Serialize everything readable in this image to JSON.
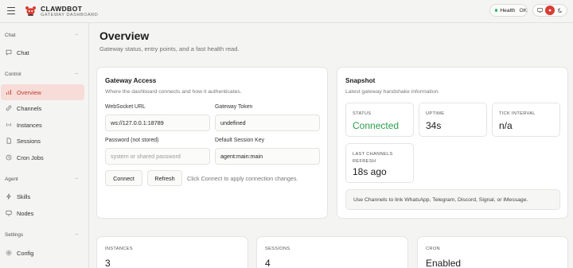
{
  "brand": {
    "title": "CLAWDBOT",
    "subtitle": "GATEWAY DASHBOARD"
  },
  "health": {
    "label": "Health",
    "status": "OK",
    "status_color": "#2fb85a"
  },
  "sidebar": {
    "sections": [
      {
        "label": "Chat",
        "items": [
          {
            "label": "Chat",
            "icon": "chat-icon"
          }
        ]
      },
      {
        "label": "Control",
        "items": [
          {
            "label": "Overview",
            "icon": "bar-chart-icon",
            "active": true
          },
          {
            "label": "Channels",
            "icon": "link-icon"
          },
          {
            "label": "Instances",
            "icon": "broadcast-icon"
          },
          {
            "label": "Sessions",
            "icon": "document-icon"
          },
          {
            "label": "Cron Jobs",
            "icon": "clock-icon"
          }
        ]
      },
      {
        "label": "Agent",
        "items": [
          {
            "label": "Skills",
            "icon": "bolt-icon"
          },
          {
            "label": "Nodes",
            "icon": "monitor-icon"
          }
        ]
      },
      {
        "label": "Settings",
        "items": [
          {
            "label": "Config",
            "icon": "gear-icon"
          }
        ]
      }
    ]
  },
  "page": {
    "title": "Overview",
    "subtitle": "Gateway status, entry points, and a fast health read."
  },
  "gateway": {
    "title": "Gateway Access",
    "subtitle": "Where the dashboard connects and how it authenticates.",
    "ws_label": "WebSocket URL",
    "ws_value": "ws://127.0.0.1:18789",
    "token_label": "Gateway Token",
    "token_value": "undefined",
    "password_label": "Password (not stored)",
    "password_placeholder": "system or shared password",
    "session_label": "Default Session Key",
    "session_value": "agent:main:main",
    "connect_label": "Connect",
    "refresh_label": "Refresh",
    "hint": "Click Connect to apply connection changes."
  },
  "snapshot": {
    "title": "Snapshot",
    "subtitle": "Latest gateway handshake information.",
    "status_label": "STATUS",
    "status_value": "Connected",
    "uptime_label": "UPTIME",
    "uptime_value": "34s",
    "tick_label": "TICK INTERVAL",
    "tick_value": "n/a",
    "refresh_label_1": "LAST CHANNELS",
    "refresh_label_2": "REFRESH",
    "refresh_value": "18s ago",
    "note": "Use Channels to link WhatsApp, Telegram, Discord, Signal, or iMessage."
  },
  "bottom": {
    "instances_label": "INSTANCES",
    "instances_value": "3",
    "sessions_label": "SESSIONS",
    "sessions_value": "4",
    "cron_label": "CRON",
    "cron_value": "Enabled"
  },
  "colors": {
    "accent": "#d93c33",
    "active_bg": "#f7dcd8",
    "connected": "#2a9d4b"
  }
}
